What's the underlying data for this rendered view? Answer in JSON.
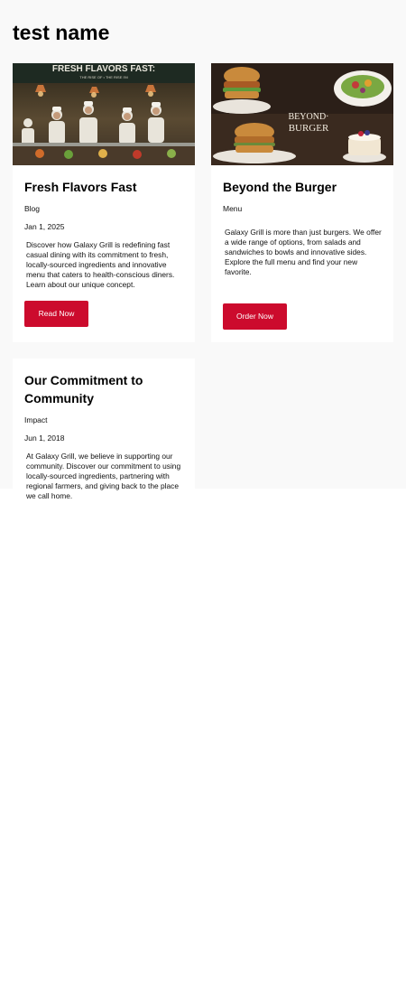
{
  "page": {
    "title": "test name"
  },
  "cards": [
    {
      "title": "Fresh Flavors Fast",
      "category": "Blog",
      "date": "Jan 1, 2025",
      "description": "Discover how Galaxy Grill is redefining fast casual dining with its commitment to fresh, locally-sourced ingredients and innovative menu that caters to health-conscious diners. Learn about our unique concept.",
      "button_label": "Read Now",
      "image_sign_text": "FRESH FLAVORS FAST:",
      "image_sign_subtext": "THE RISE OF • THE RISE I'M"
    },
    {
      "title": "Beyond the Burger",
      "category": "Menu",
      "date": "",
      "description": "Galaxy Grill is more than just burgers. We offer a wide range of options, from salads and sandwiches to bowls and innovative sides. Explore the full menu and find your new favorite.",
      "button_label": "Order Now",
      "image_text_line1": "BEYOND·",
      "image_text_line2": "BURGER"
    },
    {
      "title": "Our Commitment to Community",
      "category": "Impact",
      "date": "Jun 1, 2018",
      "description": "At Galaxy Grill, we believe in supporting our community. Discover our commitment to using locally-sourced ingredients, partnering with regional farmers, and giving back to the place we call home."
    }
  ],
  "colors": {
    "button": "#cc0b2d",
    "page_background": "#f9f9f9"
  }
}
